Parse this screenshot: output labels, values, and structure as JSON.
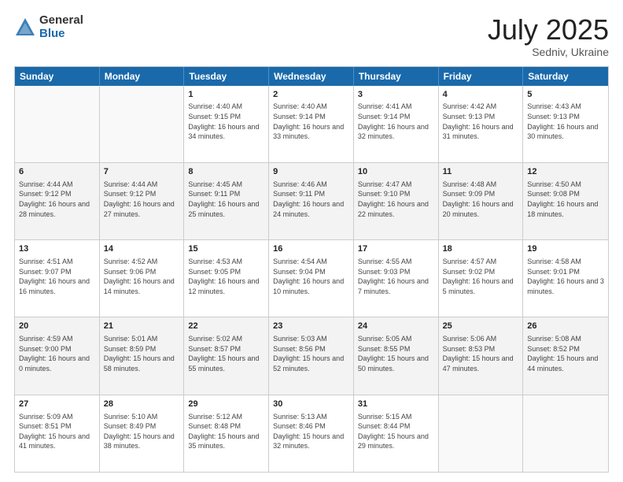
{
  "logo": {
    "general": "General",
    "blue": "Blue"
  },
  "title": {
    "month": "July 2025",
    "location": "Sedniv, Ukraine"
  },
  "header_days": [
    "Sunday",
    "Monday",
    "Tuesday",
    "Wednesday",
    "Thursday",
    "Friday",
    "Saturday"
  ],
  "weeks": [
    [
      {
        "day": "",
        "sunrise": "",
        "sunset": "",
        "daylight": ""
      },
      {
        "day": "",
        "sunrise": "",
        "sunset": "",
        "daylight": ""
      },
      {
        "day": "1",
        "sunrise": "Sunrise: 4:40 AM",
        "sunset": "Sunset: 9:15 PM",
        "daylight": "Daylight: 16 hours and 34 minutes."
      },
      {
        "day": "2",
        "sunrise": "Sunrise: 4:40 AM",
        "sunset": "Sunset: 9:14 PM",
        "daylight": "Daylight: 16 hours and 33 minutes."
      },
      {
        "day": "3",
        "sunrise": "Sunrise: 4:41 AM",
        "sunset": "Sunset: 9:14 PM",
        "daylight": "Daylight: 16 hours and 32 minutes."
      },
      {
        "day": "4",
        "sunrise": "Sunrise: 4:42 AM",
        "sunset": "Sunset: 9:13 PM",
        "daylight": "Daylight: 16 hours and 31 minutes."
      },
      {
        "day": "5",
        "sunrise": "Sunrise: 4:43 AM",
        "sunset": "Sunset: 9:13 PM",
        "daylight": "Daylight: 16 hours and 30 minutes."
      }
    ],
    [
      {
        "day": "6",
        "sunrise": "Sunrise: 4:44 AM",
        "sunset": "Sunset: 9:12 PM",
        "daylight": "Daylight: 16 hours and 28 minutes."
      },
      {
        "day": "7",
        "sunrise": "Sunrise: 4:44 AM",
        "sunset": "Sunset: 9:12 PM",
        "daylight": "Daylight: 16 hours and 27 minutes."
      },
      {
        "day": "8",
        "sunrise": "Sunrise: 4:45 AM",
        "sunset": "Sunset: 9:11 PM",
        "daylight": "Daylight: 16 hours and 25 minutes."
      },
      {
        "day": "9",
        "sunrise": "Sunrise: 4:46 AM",
        "sunset": "Sunset: 9:11 PM",
        "daylight": "Daylight: 16 hours and 24 minutes."
      },
      {
        "day": "10",
        "sunrise": "Sunrise: 4:47 AM",
        "sunset": "Sunset: 9:10 PM",
        "daylight": "Daylight: 16 hours and 22 minutes."
      },
      {
        "day": "11",
        "sunrise": "Sunrise: 4:48 AM",
        "sunset": "Sunset: 9:09 PM",
        "daylight": "Daylight: 16 hours and 20 minutes."
      },
      {
        "day": "12",
        "sunrise": "Sunrise: 4:50 AM",
        "sunset": "Sunset: 9:08 PM",
        "daylight": "Daylight: 16 hours and 18 minutes."
      }
    ],
    [
      {
        "day": "13",
        "sunrise": "Sunrise: 4:51 AM",
        "sunset": "Sunset: 9:07 PM",
        "daylight": "Daylight: 16 hours and 16 minutes."
      },
      {
        "day": "14",
        "sunrise": "Sunrise: 4:52 AM",
        "sunset": "Sunset: 9:06 PM",
        "daylight": "Daylight: 16 hours and 14 minutes."
      },
      {
        "day": "15",
        "sunrise": "Sunrise: 4:53 AM",
        "sunset": "Sunset: 9:05 PM",
        "daylight": "Daylight: 16 hours and 12 minutes."
      },
      {
        "day": "16",
        "sunrise": "Sunrise: 4:54 AM",
        "sunset": "Sunset: 9:04 PM",
        "daylight": "Daylight: 16 hours and 10 minutes."
      },
      {
        "day": "17",
        "sunrise": "Sunrise: 4:55 AM",
        "sunset": "Sunset: 9:03 PM",
        "daylight": "Daylight: 16 hours and 7 minutes."
      },
      {
        "day": "18",
        "sunrise": "Sunrise: 4:57 AM",
        "sunset": "Sunset: 9:02 PM",
        "daylight": "Daylight: 16 hours and 5 minutes."
      },
      {
        "day": "19",
        "sunrise": "Sunrise: 4:58 AM",
        "sunset": "Sunset: 9:01 PM",
        "daylight": "Daylight: 16 hours and 3 minutes."
      }
    ],
    [
      {
        "day": "20",
        "sunrise": "Sunrise: 4:59 AM",
        "sunset": "Sunset: 9:00 PM",
        "daylight": "Daylight: 16 hours and 0 minutes."
      },
      {
        "day": "21",
        "sunrise": "Sunrise: 5:01 AM",
        "sunset": "Sunset: 8:59 PM",
        "daylight": "Daylight: 15 hours and 58 minutes."
      },
      {
        "day": "22",
        "sunrise": "Sunrise: 5:02 AM",
        "sunset": "Sunset: 8:57 PM",
        "daylight": "Daylight: 15 hours and 55 minutes."
      },
      {
        "day": "23",
        "sunrise": "Sunrise: 5:03 AM",
        "sunset": "Sunset: 8:56 PM",
        "daylight": "Daylight: 15 hours and 52 minutes."
      },
      {
        "day": "24",
        "sunrise": "Sunrise: 5:05 AM",
        "sunset": "Sunset: 8:55 PM",
        "daylight": "Daylight: 15 hours and 50 minutes."
      },
      {
        "day": "25",
        "sunrise": "Sunrise: 5:06 AM",
        "sunset": "Sunset: 8:53 PM",
        "daylight": "Daylight: 15 hours and 47 minutes."
      },
      {
        "day": "26",
        "sunrise": "Sunrise: 5:08 AM",
        "sunset": "Sunset: 8:52 PM",
        "daylight": "Daylight: 15 hours and 44 minutes."
      }
    ],
    [
      {
        "day": "27",
        "sunrise": "Sunrise: 5:09 AM",
        "sunset": "Sunset: 8:51 PM",
        "daylight": "Daylight: 15 hours and 41 minutes."
      },
      {
        "day": "28",
        "sunrise": "Sunrise: 5:10 AM",
        "sunset": "Sunset: 8:49 PM",
        "daylight": "Daylight: 15 hours and 38 minutes."
      },
      {
        "day": "29",
        "sunrise": "Sunrise: 5:12 AM",
        "sunset": "Sunset: 8:48 PM",
        "daylight": "Daylight: 15 hours and 35 minutes."
      },
      {
        "day": "30",
        "sunrise": "Sunrise: 5:13 AM",
        "sunset": "Sunset: 8:46 PM",
        "daylight": "Daylight: 15 hours and 32 minutes."
      },
      {
        "day": "31",
        "sunrise": "Sunrise: 5:15 AM",
        "sunset": "Sunset: 8:44 PM",
        "daylight": "Daylight: 15 hours and 29 minutes."
      },
      {
        "day": "",
        "sunrise": "",
        "sunset": "",
        "daylight": ""
      },
      {
        "day": "",
        "sunrise": "",
        "sunset": "",
        "daylight": ""
      }
    ]
  ]
}
